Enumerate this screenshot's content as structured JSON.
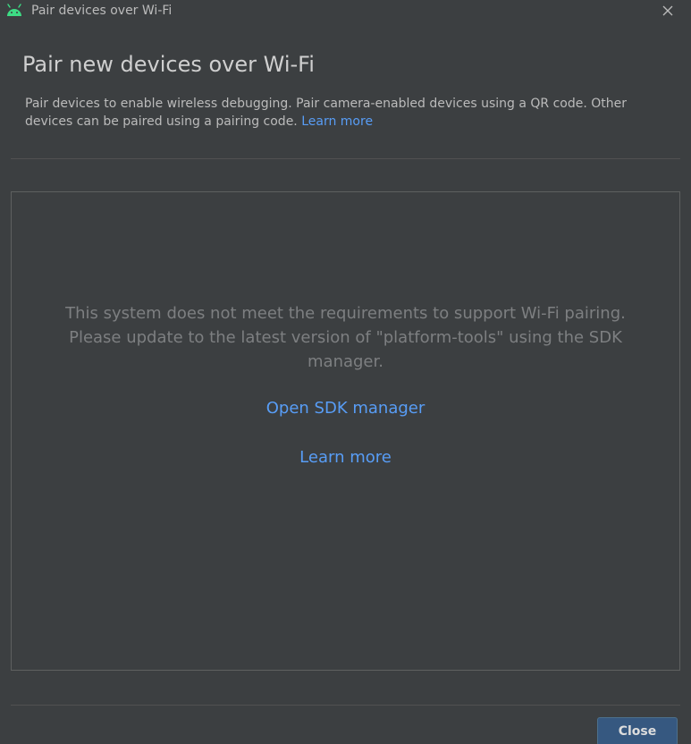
{
  "window": {
    "title": "Pair devices over Wi-Fi",
    "app_icon": "android-icon",
    "close_icon": "close-icon"
  },
  "header": {
    "heading": "Pair new devices over Wi-Fi",
    "description": "Pair devices to enable wireless debugging. Pair camera-enabled devices using a QR code. Other devices can be paired using a pairing code.",
    "learn_more": "Learn more"
  },
  "panel": {
    "message_lines": [
      "This system does not meet the requirements to support Wi-Fi pairing.",
      "Please update to the latest version of \"platform-tools\" using the SDK",
      "manager."
    ],
    "open_sdk_manager": "Open SDK manager",
    "learn_more": "Learn more"
  },
  "footer": {
    "close_label": "Close"
  },
  "colors": {
    "background": "#3c3f41",
    "link": "#589df6",
    "primary_button": "#365880",
    "android_green": "#3ddc84"
  }
}
